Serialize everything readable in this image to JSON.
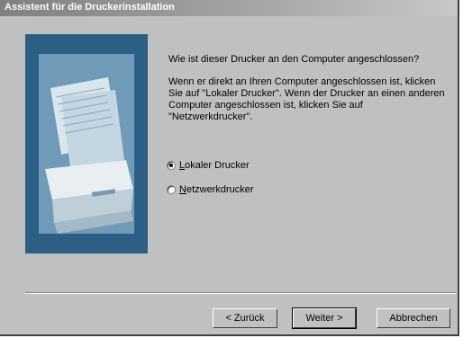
{
  "window": {
    "title": "Assistent für die Druckerinstallation"
  },
  "content": {
    "question": "Wie ist dieser Drucker an den Computer angeschlossen?",
    "info": "Wenn er direkt an Ihren Computer angeschlossen ist, klicken Sie auf \"Lokaler Drucker\". Wenn der Drucker an einen anderen Computer angeschlossen ist, klicken Sie auf \"Netzwerkdrucker\".",
    "options": [
      {
        "label": "Lokaler Drucker",
        "checked": true
      },
      {
        "label": "Netzwerkdrucker",
        "checked": false
      }
    ]
  },
  "buttons": {
    "back": "< Zurück",
    "next": "Weiter >",
    "cancel": "Abbrechen"
  },
  "colors": {
    "panel": "#2d5f86",
    "dialog": "#c0c0c0"
  }
}
